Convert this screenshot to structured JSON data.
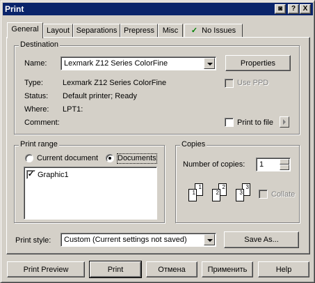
{
  "window": {
    "title": "Print",
    "title_buttons": [
      "◙",
      "?",
      "X"
    ]
  },
  "tabs": [
    "General",
    "Layout",
    "Separations",
    "Prepress",
    "Misc",
    "No Issues"
  ],
  "destination": {
    "group_title": "Destination",
    "name_label": "Name:",
    "name_value": "Lexmark Z12 Series ColorFine",
    "properties_button": "Properties",
    "type_label": "Type:",
    "type_value": "Lexmark Z12 Series ColorFine",
    "status_label": "Status:",
    "status_value": "Default printer; Ready",
    "where_label": "Where:",
    "where_value": "LPT1:",
    "comment_label": "Comment:",
    "use_ppd_label": "Use PPD",
    "print_to_file_label": "Print to file"
  },
  "print_range": {
    "group_title": "Print range",
    "current_document": "Current document",
    "documents": "Documents",
    "items": [
      "Graphic1"
    ]
  },
  "copies": {
    "group_title": "Copies",
    "number_label": "Number of copies:",
    "number_value": "1",
    "collate_label": "Collate",
    "page_numbers": [
      "1",
      "1",
      "2",
      "2",
      "3",
      "3"
    ]
  },
  "print_style": {
    "label": "Print style:",
    "value": "Custom (Current settings not saved)",
    "save_as_button": "Save As..."
  },
  "buttons": {
    "print_preview": "Print Preview",
    "print": "Print",
    "cancel": "Отмена",
    "apply": "Применить",
    "help": "Help"
  },
  "colors": {
    "titlebar": "#0a246a",
    "face": "#d4d0c8",
    "disabled_text": "#808080"
  }
}
